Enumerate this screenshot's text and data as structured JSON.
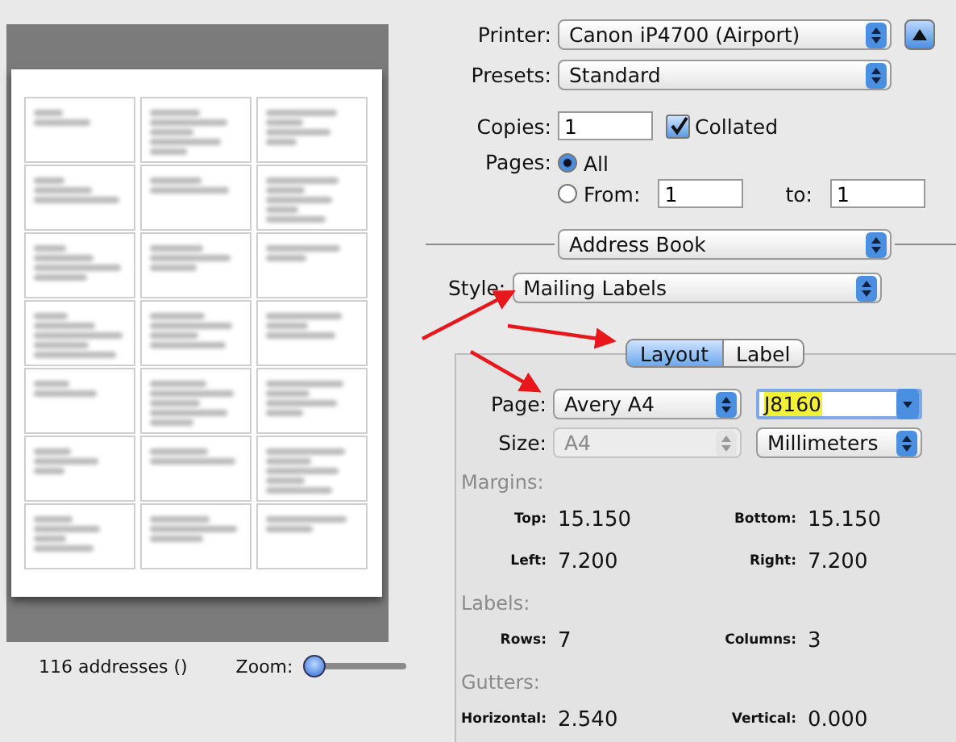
{
  "preview": {
    "address_count": "116 addresses ()",
    "zoom": {
      "label": "Zoom:",
      "level": 0
    }
  },
  "printer": {
    "label": "Printer:",
    "value": "Canon iP4700 (Airport)"
  },
  "presets": {
    "label": "Presets:",
    "value": "Standard"
  },
  "copies": {
    "label": "Copies:",
    "value": "1",
    "collated": {
      "label": "Collated",
      "checked": true
    }
  },
  "pages": {
    "label": "Pages:",
    "options": [
      {
        "label": "All",
        "selected": true
      },
      {
        "label": "From:",
        "selected": false
      }
    ],
    "from": "1",
    "to_label": "to:",
    "to": "1"
  },
  "section": "Address Book",
  "style": {
    "label": "Style:",
    "value": "Mailing Labels"
  },
  "tabs": [
    {
      "label": "Layout",
      "selected": true
    },
    {
      "label": "Label",
      "selected": false
    }
  ],
  "page": {
    "label": "Page:",
    "value": "Avery A4",
    "product": "J8160",
    "highlighted": true
  },
  "size": {
    "label": "Size:",
    "value": "A4",
    "disabled": true,
    "units": "Millimeters"
  },
  "groups": [
    {
      "title": "Margins:",
      "fields": [
        {
          "label": "Top:",
          "value": "15.150"
        },
        {
          "label": "Bottom:",
          "value": "15.150"
        },
        {
          "label": "Left:",
          "value": "7.200"
        },
        {
          "label": "Right:",
          "value": "7.200"
        }
      ]
    },
    {
      "title": "Labels:",
      "fields": [
        {
          "label": "Rows:",
          "value": "7"
        },
        {
          "label": "Columns:",
          "value": "3"
        }
      ]
    },
    {
      "title": "Gutters:",
      "fields": [
        {
          "label": "Horizontal:",
          "value": "2.540"
        },
        {
          "label": "Vertical:",
          "value": "0.000"
        }
      ]
    }
  ]
}
